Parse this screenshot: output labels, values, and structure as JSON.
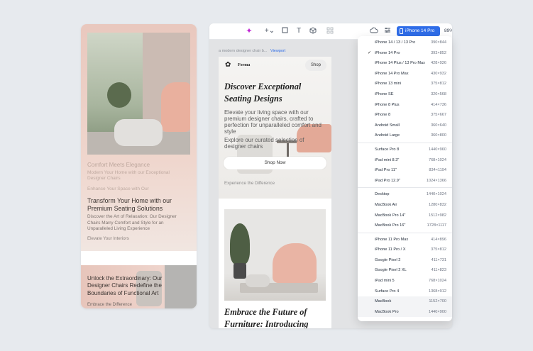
{
  "left_preview": {
    "ghost_lines": [
      "Comfort Meets Elegance",
      "Modern Your Home with our Exceptional",
      "Designer Chairs",
      "Enhance Your Space with Our"
    ],
    "title": "Transform Your Home with our Premium Seating Solutions",
    "subtitle": "Discover the Art of Relaxation: Our Designer Chairs Marry Comfort and Style for an Unparalleled Living Experience",
    "link": "Elevate Your Interiors",
    "band_title": "Unlock the Extraordinary: Our Designer Chairs Redefine the Boundaries of Functional Art",
    "band_link": "Embrace the Difference"
  },
  "toolbar": {
    "device_label": "iPhone 14 Pro",
    "zoom": "89%"
  },
  "canvas": {
    "caption": "a modern designer chair b...",
    "viewport_label": "Viewport"
  },
  "frame": {
    "brand": "Forma",
    "shop_button": "Shop",
    "hero_title": "Discover Exceptional Seating Designs",
    "hero_desc_1": "Elevate your living space with our premium designer chairs, crafted to perfection for unparalleled comfort and style",
    "hero_desc_2": "Explore our curated selection of designer chairs",
    "shop_now": "Shop Now",
    "experience": "Experience the Difference",
    "section_title": "Embrace the Future of Furniture: Introducing"
  },
  "devices": {
    "selected": "iPhone 14 Pro",
    "groups": [
      [
        {
          "name": "iPhone 14 / 13 / 13 Pro",
          "size": "390×844"
        },
        {
          "name": "iPhone 14 Pro",
          "size": "393×852"
        },
        {
          "name": "iPhone 14 Plus / 13 Pro Max",
          "size": "428×926"
        },
        {
          "name": "iPhone 14 Pro Max",
          "size": "430×932"
        },
        {
          "name": "iPhone 13 mini",
          "size": "375×812"
        },
        {
          "name": "iPhone SE",
          "size": "320×568"
        },
        {
          "name": "iPhone 8 Plus",
          "size": "414×736"
        },
        {
          "name": "iPhone 8",
          "size": "375×667"
        },
        {
          "name": "Android Small",
          "size": "360×640"
        },
        {
          "name": "Android Large",
          "size": "360×800"
        }
      ],
      [
        {
          "name": "Surface Pro 8",
          "size": "1440×960"
        },
        {
          "name": "iPad mini 8.3\"",
          "size": "768×1024"
        },
        {
          "name": "iPad Pro 11\"",
          "size": "834×1194"
        },
        {
          "name": "iPad Pro 12.9\"",
          "size": "1024×1366"
        }
      ],
      [
        {
          "name": "Desktop",
          "size": "1440×1024"
        },
        {
          "name": "MacBook Air",
          "size": "1280×832"
        },
        {
          "name": "MacBook Pro 14\"",
          "size": "1512×982"
        },
        {
          "name": "MacBook Pro 16\"",
          "size": "1728×1117"
        }
      ],
      [
        {
          "name": "iPhone 11 Pro Max",
          "size": "414×896"
        },
        {
          "name": "iPhone 11 Pro / X",
          "size": "375×812"
        },
        {
          "name": "Google Pixel 2",
          "size": "411×731"
        },
        {
          "name": "Google Pixel 2 XL",
          "size": "411×823"
        },
        {
          "name": "iPad mini 5",
          "size": "768×1024"
        },
        {
          "name": "Surface Pro 4",
          "size": "1368×912"
        },
        {
          "name": "MacBook",
          "size": "1152×700"
        },
        {
          "name": "MacBook Pro",
          "size": "1440×900"
        }
      ]
    ]
  },
  "icons": {
    "sparkle": "sparkle-icon",
    "add": "plus-icon",
    "frame": "square-icon",
    "text": "text-icon",
    "cube": "cube-icon",
    "components": "components-icon",
    "cloud": "cloud-icon",
    "settings": "sliders-icon",
    "phone": "phone-icon",
    "chevron": "chevron-up-icon",
    "check": "check-icon",
    "logo": "flower-logo-icon"
  },
  "colors": {
    "accent": "#2f6de8",
    "sparkle": "#c026d3",
    "blush": "#e9c8be"
  }
}
